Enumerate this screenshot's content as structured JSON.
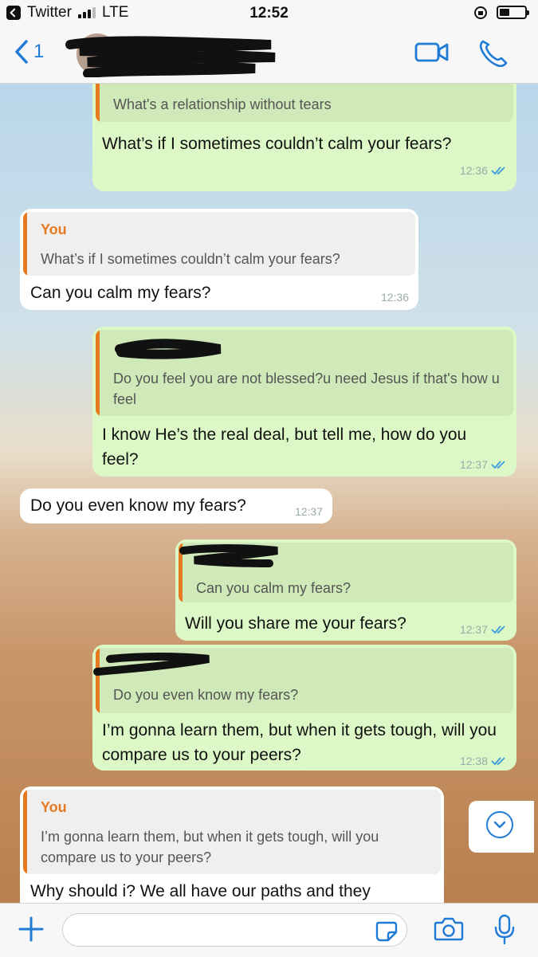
{
  "status": {
    "app": "Twitter",
    "network": "LTE",
    "time": "12:52"
  },
  "nav": {
    "back_count": "1"
  },
  "messages": [
    {
      "quote_text": "What's a relationship without tears",
      "text": "What’s if I sometimes couldn’t calm your fears?",
      "time": "12:36"
    },
    {
      "quote_author": "You",
      "quote_text": "What’s if I sometimes couldn’t calm your fears?",
      "text": "Can you calm my fears?",
      "time": "12:36"
    },
    {
      "quote_text": "Do you feel you are not blessed?u need Jesus if that's how u feel",
      "text": "I know He’s the real deal, but tell me, how do you feel?",
      "time": "12:37"
    },
    {
      "text": "Do you even know my fears?",
      "time": "12:37"
    },
    {
      "quote_text": "Can you calm my fears?",
      "text": "Will you share me your fears?",
      "time": "12:37"
    },
    {
      "quote_text": "Do you even know my fears?",
      "text": "I’m gonna learn them, but when it gets tough, will you compare us to your peers?",
      "time": "12:38"
    },
    {
      "quote_author": "You",
      "quote_text": "I’m gonna learn them, but when it gets tough, will you compare us to your peers?",
      "text": "Why should i? We all have our paths and they"
    }
  ],
  "colors": {
    "accent": "#1f7bd6",
    "outgoing": "#dcf8c6",
    "incoming": "#ffffff",
    "quote_bar": "#e77a20",
    "ticks": "#3a9be0"
  }
}
